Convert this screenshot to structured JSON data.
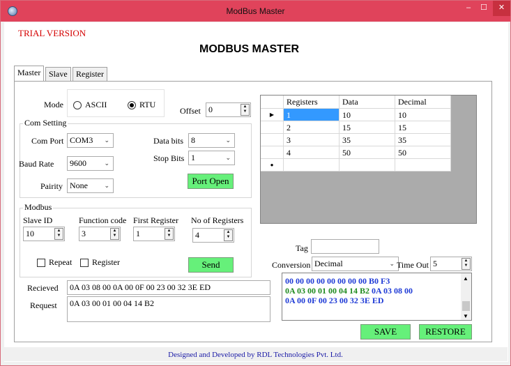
{
  "window": {
    "title": "ModBus Master",
    "controls": {
      "minimize": "–",
      "maximize": "☐",
      "close": "✕"
    }
  },
  "trial_banner": "TRIAL VERSION",
  "main_title": "MODBUS MASTER",
  "tabs": [
    {
      "label": "Master",
      "active": true
    },
    {
      "label": "Slave",
      "active": false
    },
    {
      "label": "Register",
      "active": false
    }
  ],
  "mode": {
    "label": "Mode",
    "options": [
      "ASCII",
      "RTU"
    ],
    "selected": "RTU"
  },
  "offset": {
    "label": "Offset",
    "value": "0"
  },
  "com_setting": {
    "title": "Com Setting",
    "com_port": {
      "label": "Com Port",
      "value": "COM3"
    },
    "baud_rate": {
      "label": "Baud Rate",
      "value": "9600"
    },
    "parity": {
      "label": "Pairity",
      "value": "None"
    },
    "data_bits": {
      "label": "Data bits",
      "value": "8"
    },
    "stop_bits": {
      "label": "Stop Bits",
      "value": "1"
    },
    "port_button": "Port Open"
  },
  "modbus": {
    "title": "Modbus",
    "slave_id": {
      "label": "Slave ID",
      "value": "10"
    },
    "function_code": {
      "label": "Function code",
      "value": "3"
    },
    "first_register": {
      "label": "First Register",
      "value": "1"
    },
    "no_of_registers": {
      "label": "No of Registers",
      "value": "4"
    },
    "repeat_label": "Repeat",
    "register_label": "Register",
    "send_button": "Send"
  },
  "grid": {
    "columns": [
      "Registers",
      "Data",
      "Decimal"
    ],
    "rows": [
      [
        "1",
        "10",
        "10"
      ],
      [
        "2",
        "15",
        "15"
      ],
      [
        "3",
        "35",
        "35"
      ],
      [
        "4",
        "50",
        "50"
      ]
    ],
    "current_row_marker": "▶",
    "new_row_marker": "●"
  },
  "tag": {
    "label": "Tag",
    "value": ""
  },
  "conversion": {
    "label": "Conversion",
    "value": "Decimal"
  },
  "timeout": {
    "label": "Time Out",
    "value": "5"
  },
  "received": {
    "label": "Recieved",
    "value": "0A 03 08 00 0A 00 0F 00 23 00 32 3E ED"
  },
  "request": {
    "label": "Request",
    "value": "0A 03 00 01 00 04 14 B2"
  },
  "log": {
    "line1": "00 00 00 00 00 00 00 00 B0 F3",
    "line2_green": "0A 03 00 01 00 04 14 B2",
    "line2_blue": " 0A 03 08 00",
    "line3": "0A 00 0F 00 23 00 32 3E ED"
  },
  "save_button": "SAVE",
  "restore_button": "RESTORE",
  "footer": "Designed and Developed by RDL Technologies Pvt. Ltd.",
  "colors": {
    "titlebar": "#e0435b",
    "trial": "#d40000",
    "green_button": "#66f07a",
    "selection": "#3399ff",
    "log_blue": "#1f3bd6",
    "log_green": "#1f8a1f",
    "footer_text": "#1a1aa6"
  }
}
